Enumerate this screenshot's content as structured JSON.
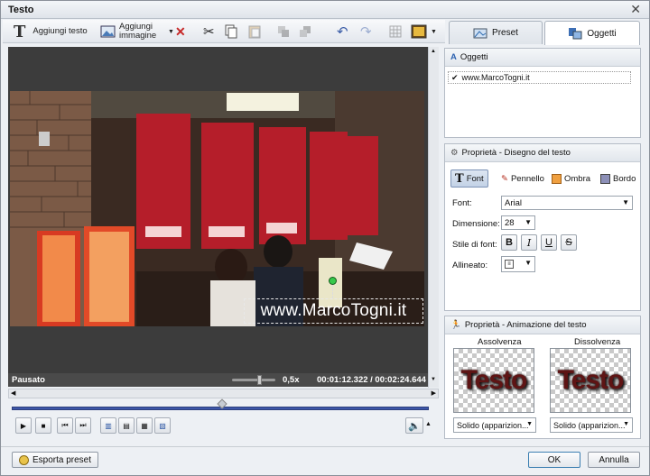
{
  "window": {
    "title": "Testo"
  },
  "toolbar": {
    "add_text": "Aggiungi testo",
    "add_image": "Aggiungi immagine"
  },
  "tabs": [
    {
      "label": "Preset"
    },
    {
      "label": "Oggetti"
    }
  ],
  "objects": {
    "header": "Oggetti",
    "items": [
      "www.MarcoTogni.it"
    ]
  },
  "viewer": {
    "watermark": "www.MarcoTogni.it",
    "status": "Pausato",
    "zoom": "0,5x",
    "time": "00:01:12.322 / 00:02:24.644"
  },
  "properties": {
    "header": "Proprietà - Disegno del testo",
    "subtabs": [
      "Font",
      "Pennello",
      "Ombra",
      "Bordo"
    ],
    "font_label": "Font:",
    "font_value": "Arial",
    "size_label": "Dimensione:",
    "size_value": "28",
    "style_label": "Stile di font:",
    "style_buttons": [
      "B",
      "I",
      "U",
      "S"
    ],
    "align_label": "Allineato:"
  },
  "animation": {
    "header": "Proprietà - Animazione del testo",
    "fade_in": "Assolvenza",
    "fade_out": "Dissolvenza",
    "preview_text": "Testo",
    "fade_in_select": "Solido (apparizion...",
    "fade_out_select": "Solido (apparizion..."
  },
  "footer": {
    "export": "Esporta preset",
    "ok": "OK",
    "cancel": "Annulla"
  },
  "colors": {
    "accent": "#3d56a8",
    "banner": "#b51e2a"
  }
}
